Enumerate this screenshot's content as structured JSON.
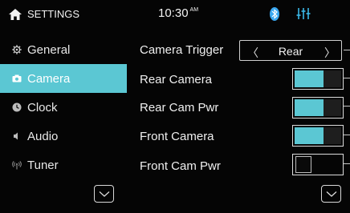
{
  "header": {
    "title": "SETTINGS",
    "time": "10:30",
    "ampm": "AM"
  },
  "colors": {
    "accent": "#5bc7d3",
    "background": "#050505",
    "text": "#f2f2f2"
  },
  "sidebar": {
    "items": [
      {
        "label": "General",
        "icon": "gear-icon",
        "active": false
      },
      {
        "label": "Camera",
        "icon": "camera-icon",
        "active": true
      },
      {
        "label": "Clock",
        "icon": "clock-icon",
        "active": false
      },
      {
        "label": "Audio",
        "icon": "speaker-icon",
        "active": false
      },
      {
        "label": "Tuner",
        "icon": "antenna-icon",
        "active": false
      }
    ]
  },
  "settings": {
    "camera_trigger": {
      "label": "Camera Trigger",
      "value": "Rear"
    },
    "rear_camera": {
      "label": "Rear Camera",
      "on": true
    },
    "rear_cam_pwr": {
      "label": "Rear Cam Pwr",
      "on": true
    },
    "front_camera": {
      "label": "Front Camera",
      "on": true
    },
    "front_cam_pwr": {
      "label": "Front Cam Pwr",
      "on": false
    }
  }
}
